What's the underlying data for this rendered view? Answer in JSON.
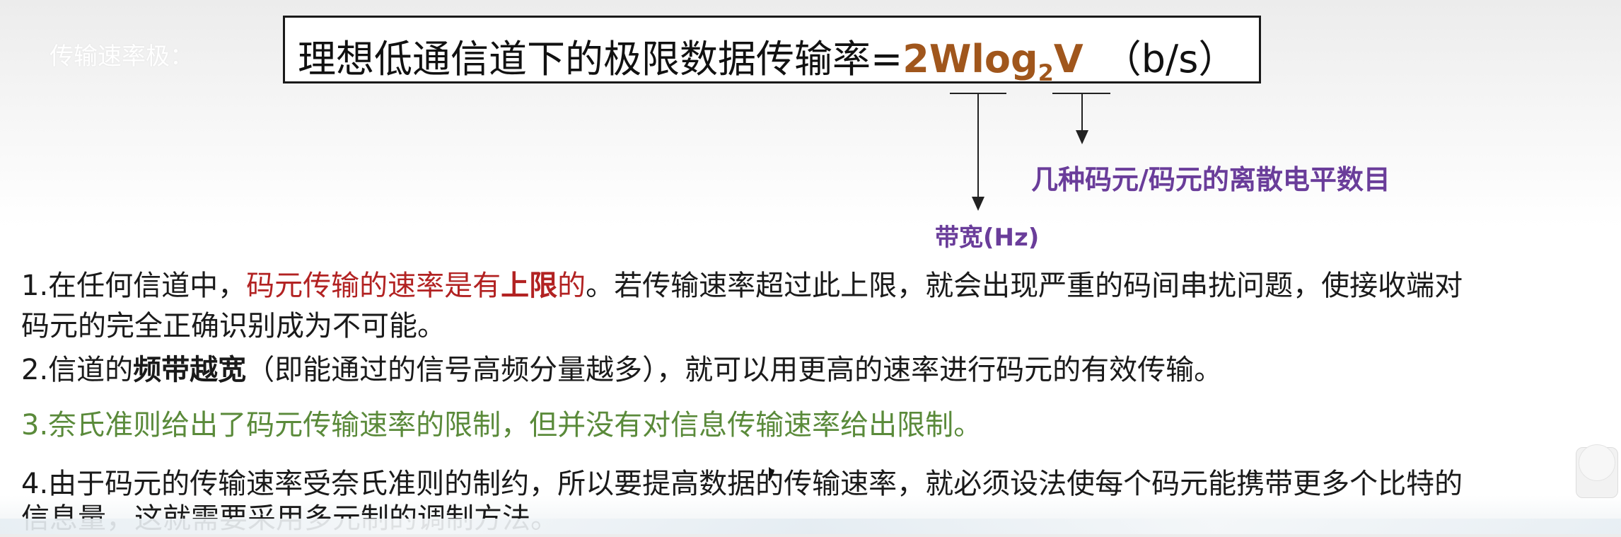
{
  "header": {
    "rate_label": "传输速率极："
  },
  "formula": {
    "prefix": "理想低通信道下的极限数据传输率=",
    "equation_main": "2Wlog",
    "equation_sub": "2",
    "equation_end": "V",
    "unit": "（b/s）"
  },
  "annotations": {
    "bandwidth": "带宽(Hz)",
    "levels": "几种码元/码元的离散电平数目"
  },
  "points": [
    {
      "line1_pre": "1.在任何信道中，",
      "line1_red": "码元传输的速率是有",
      "line1_red_bold": "上限",
      "line1_red_end": "的",
      "line1_post": "。若传输速率超过此上限，就会出现严重的码间串扰问题，使接收端对",
      "line2": "码元的完全正确识别成为不可能。"
    },
    {
      "pre": "2.信道的",
      "bold": "频带越宽",
      "post": "（即能通过的信号高频分量越多），就可以用更高的速率进行码元的有效传输。"
    },
    {
      "text": "3.奈氏准则给出了码元传输速率的限制，但并没有对信息传输速率给出限制。"
    },
    {
      "line1": "4.由于码元的传输速率受奈氏准则的制约，所以要提高数据的传输速率，就必须设法使每个码元能携带更多个比特的",
      "line2": "信息量，这就需要采用多元制的调制方法。"
    }
  ],
  "colors": {
    "formula_accent": "#a0561c",
    "annotation": "#6a3d9a",
    "highlight_red": "#b22222",
    "highlight_green": "#5a8a3a"
  }
}
